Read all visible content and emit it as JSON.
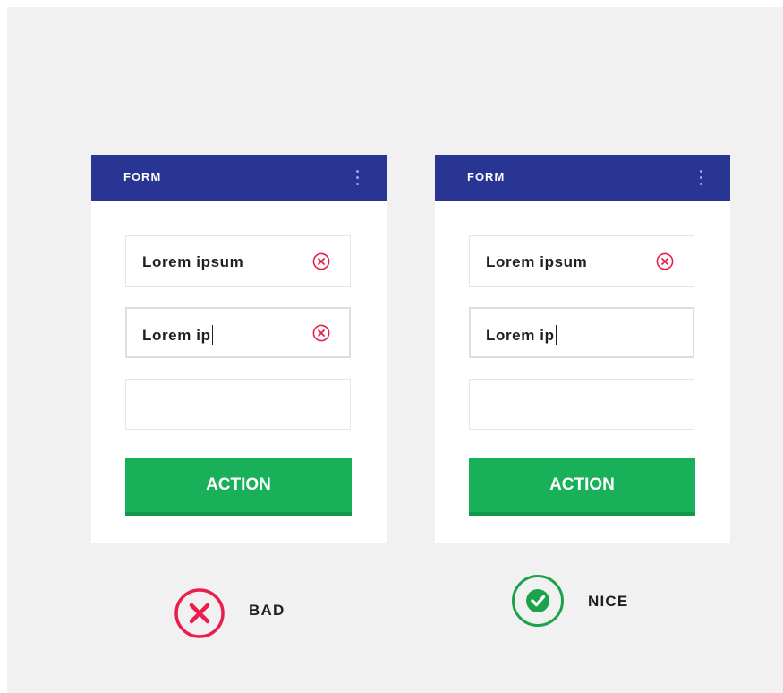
{
  "colors": {
    "header": "#283593",
    "action": "#18b15a",
    "error": "#e91e4d",
    "success": "#1aa34a",
    "background": "#f1f1f1"
  },
  "cards": [
    {
      "title": "FORM",
      "menu_icon": "kebab-menu-icon",
      "fields": [
        {
          "value": "Lorem ipsum",
          "clear_icon": "clear-circle-x-icon"
        },
        {
          "value": "Lorem ip",
          "clear_icon": "clear-circle-x-icon",
          "focused": true
        },
        {
          "value": ""
        }
      ],
      "action_label": "ACTION",
      "verdict": {
        "label": "BAD",
        "icon": "x-circle-icon"
      }
    },
    {
      "title": "FORM",
      "menu_icon": "kebab-menu-icon",
      "fields": [
        {
          "value": "Lorem ipsum",
          "clear_icon": "clear-circle-x-icon"
        },
        {
          "value": "Lorem ip",
          "focused": true
        },
        {
          "value": ""
        }
      ],
      "action_label": "ACTION",
      "verdict": {
        "label": "NICE",
        "icon": "check-circle-icon"
      }
    }
  ]
}
